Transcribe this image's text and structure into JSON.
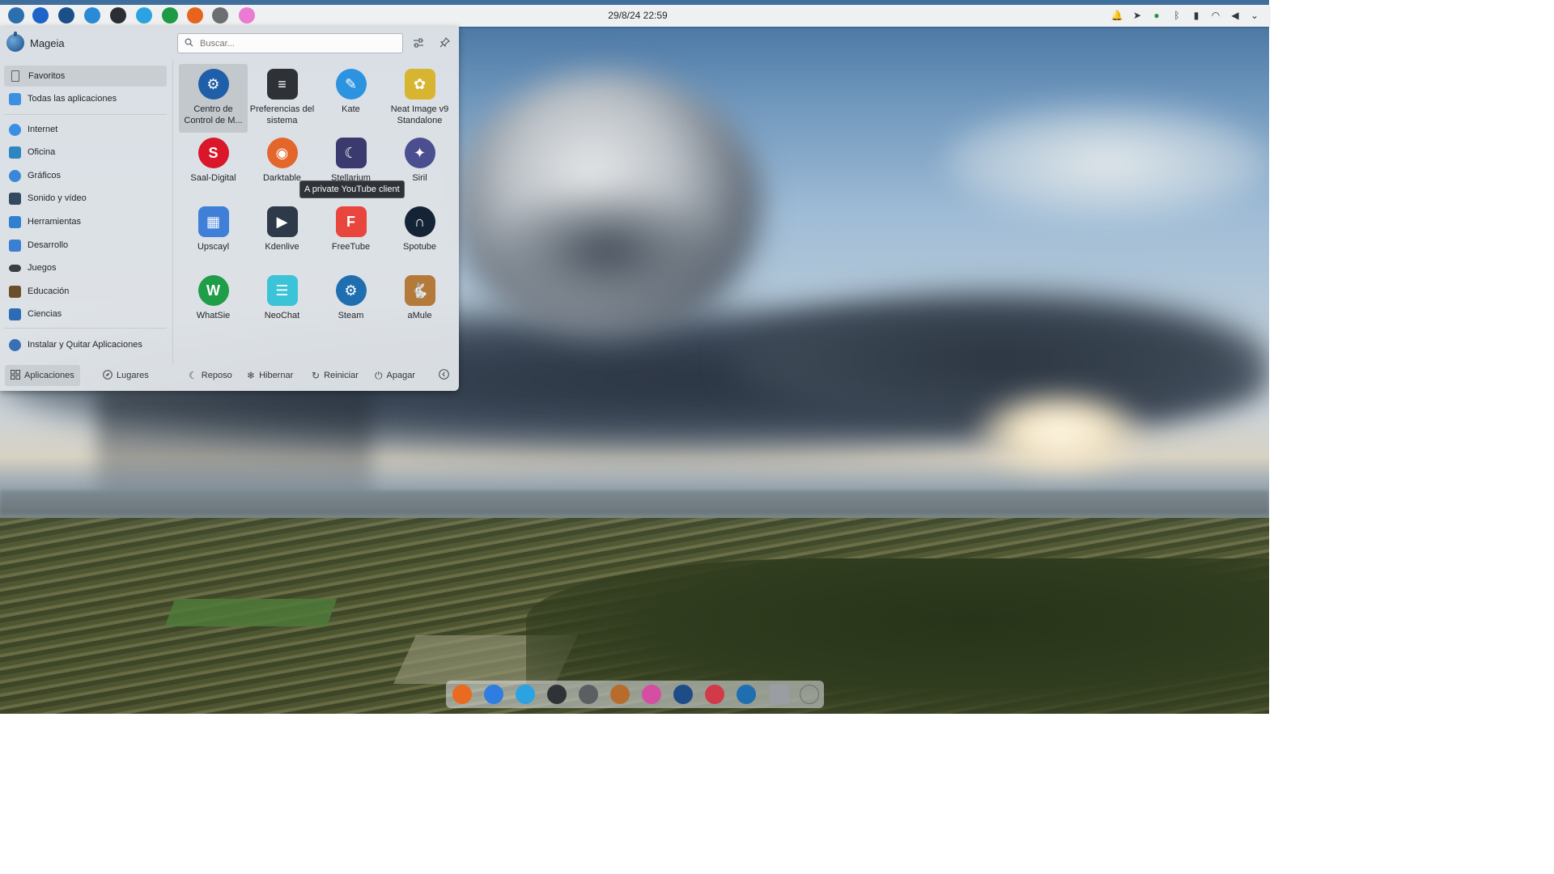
{
  "top_panel": {
    "clock": "29/8/24 22:59",
    "tasks": [
      {
        "icon": "mageia-launcher-icon",
        "color": "#2b6fae"
      },
      {
        "icon": "file-manager-icon",
        "color": "#1d63c9"
      },
      {
        "icon": "mageia-control-center-icon",
        "color": "#1b4f8a"
      },
      {
        "icon": "kate-icon",
        "color": "#2a8ad6"
      },
      {
        "icon": "terminal-icon",
        "color": "#2b2f33"
      },
      {
        "icon": "telegram-icon",
        "color": "#2aa3e0"
      },
      {
        "icon": "whatsapp-icon",
        "color": "#1c9b44"
      },
      {
        "icon": "firefox-icon",
        "color": "#e8641c"
      },
      {
        "icon": "amule-icon",
        "color": "#6b6f72"
      },
      {
        "icon": "pink-app-icon",
        "color": "#e97bd3"
      }
    ],
    "tray": [
      "notifications-icon",
      "telegram-tray-icon",
      "whatsapp-tray-icon",
      "bluetooth-icon",
      "battery-icon",
      "wifi-icon",
      "volume-icon",
      "chevron-down-icon"
    ]
  },
  "launcher": {
    "user_name": "Mageia",
    "search": {
      "placeholder": "Buscar..."
    },
    "categories": [
      {
        "label": "Favoritos",
        "icon": "bookmark-icon",
        "color": "#5c6166"
      },
      {
        "label": "Todas las aplicaciones",
        "icon": "grid-icon",
        "color": "#3d8fe0"
      },
      {
        "label": "Internet",
        "icon": "internet-icon",
        "color": "#3a8ee6"
      },
      {
        "label": "Oficina",
        "icon": "office-icon",
        "color": "#2e86c1"
      },
      {
        "label": "Gráficos",
        "icon": "graphics-icon",
        "color": "#3a87d8"
      },
      {
        "label": "Sonido y vídeo",
        "icon": "multimedia-icon",
        "color": "#34495e"
      },
      {
        "label": "Herramientas",
        "icon": "tools-icon",
        "color": "#2f80d0"
      },
      {
        "label": "Desarrollo",
        "icon": "development-icon",
        "color": "#3b7fd1"
      },
      {
        "label": "Juegos",
        "icon": "games-icon",
        "color": "#3c3f42"
      },
      {
        "label": "Educación",
        "icon": "education-icon",
        "color": "#6b4f2a"
      },
      {
        "label": "Ciencias",
        "icon": "science-icon",
        "color": "#2d6cb5"
      },
      {
        "label": "Instalar y Quitar Aplicaciones",
        "icon": "install-icon",
        "color": "#3a6fb5"
      }
    ],
    "apps": [
      {
        "label": "Centro de Control de M...",
        "icon": "mageia-control-center-icon",
        "color": "#1f5ea8",
        "glyph": "⚙"
      },
      {
        "label": "Preferencias del sistema",
        "icon": "system-settings-icon",
        "color": "#2e3236",
        "glyph": "≡"
      },
      {
        "label": "Kate",
        "icon": "kate-icon",
        "color": "#2b93e0",
        "glyph": "✎"
      },
      {
        "label": "Neat Image v9 Standalone",
        "icon": "neat-image-icon",
        "color": "#d8b531",
        "glyph": "✿"
      },
      {
        "label": "Saal-Digital",
        "icon": "saal-digital-icon",
        "color": "#d9162a",
        "glyph": "S"
      },
      {
        "label": "Darktable",
        "icon": "darktable-icon",
        "color": "#e3662b",
        "glyph": "◉"
      },
      {
        "label": "Stellarium",
        "icon": "stellarium-icon",
        "color": "#3b3a6e",
        "glyph": "☾"
      },
      {
        "label": "Siril",
        "icon": "siril-icon",
        "color": "#4b4e8f",
        "glyph": "✦"
      },
      {
        "label": "Upscayl",
        "icon": "upscayl-icon",
        "color": "#3f7fd8",
        "glyph": "▦"
      },
      {
        "label": "Kdenlive",
        "icon": "kdenlive-icon",
        "color": "#2e3a4a",
        "glyph": "▶"
      },
      {
        "label": "FreeTube",
        "icon": "freetube-icon",
        "color": "#e8453c",
        "glyph": "F"
      },
      {
        "label": "Spotube",
        "icon": "spotube-icon",
        "color": "#142436",
        "glyph": "∩"
      },
      {
        "label": "WhatSie",
        "icon": "whatsie-icon",
        "color": "#1f9d48",
        "glyph": "W"
      },
      {
        "label": "NeoChat",
        "icon": "neochat-icon",
        "color": "#3bc3d8",
        "glyph": "☰"
      },
      {
        "label": "Steam",
        "icon": "steam-icon",
        "color": "#1f6fb0",
        "glyph": "⚙"
      },
      {
        "label": "aMule",
        "icon": "amule-icon",
        "color": "#b37a3a",
        "glyph": "🐇"
      }
    ],
    "tooltip": "A private YouTube client",
    "footer": {
      "applications": "Aplicaciones",
      "places": "Lugares",
      "sleep": "Reposo",
      "hibernate": "Hibernar",
      "restart": "Reiniciar",
      "shutdown": "Apagar"
    }
  },
  "dock": {
    "items": [
      {
        "icon": "firefox-icon",
        "color": "#e96a21"
      },
      {
        "icon": "thunderbird-icon",
        "color": "#2f7de0"
      },
      {
        "icon": "telegram-icon",
        "color": "#2aa3e0"
      },
      {
        "icon": "terminal-icon",
        "color": "#2f3337"
      },
      {
        "icon": "aperture-icon",
        "color": "#5c5f62"
      },
      {
        "icon": "gimp-icon",
        "color": "#b86c2c"
      },
      {
        "icon": "krita-icon",
        "color": "#d44ea4"
      },
      {
        "icon": "mageia-control-center-icon",
        "color": "#1d4c86"
      },
      {
        "icon": "screen-recorder-icon",
        "color": "#d23a4a"
      },
      {
        "icon": "steam-icon",
        "color": "#1f6fb0"
      },
      {
        "icon": "archive-icon",
        "color": "#9a9ea2"
      },
      {
        "icon": "power-icon",
        "color": "#6a6e72"
      }
    ]
  }
}
